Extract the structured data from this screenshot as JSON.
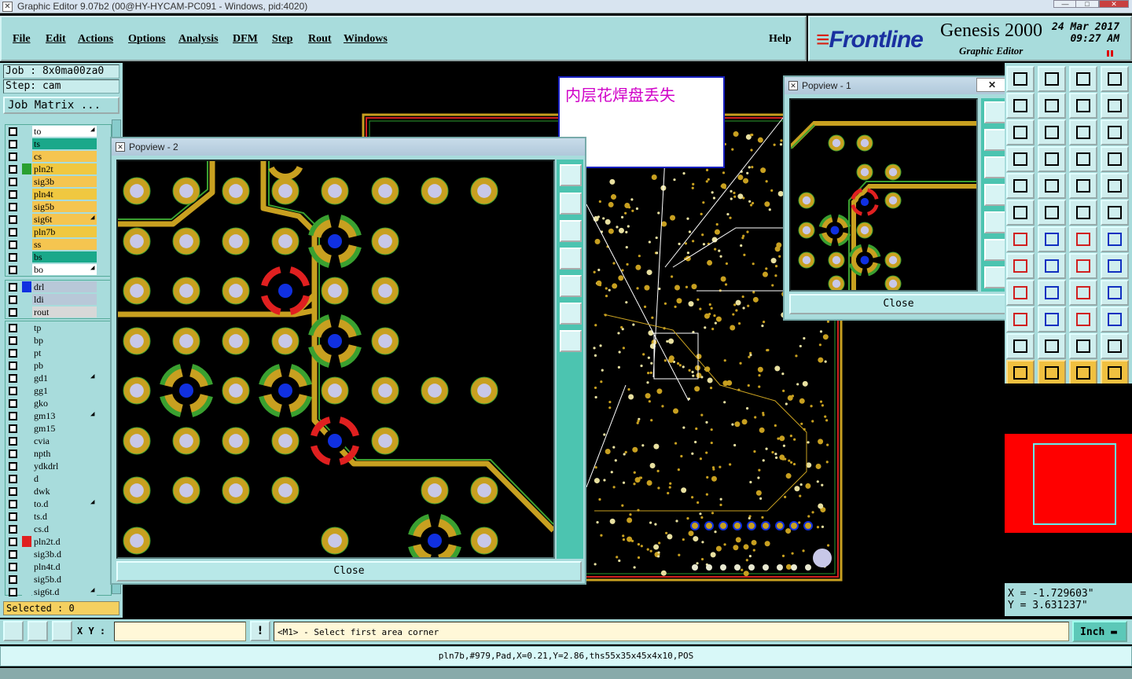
{
  "window": {
    "title": "Graphic Editor 9.07b2 (00@HY-HYCAM-PC091 - Windows, pid:4020)"
  },
  "menu": {
    "items": [
      "File",
      "Edit",
      "Actions",
      "Options",
      "Analysis",
      "DFM",
      "Step",
      "Rout",
      "Windows"
    ],
    "help": "Help"
  },
  "brand": {
    "logo": "Frontline",
    "product": "Genesis 2000",
    "subtitle": "Graphic Editor",
    "date": "24 Mar 2017",
    "time": "09:27 AM"
  },
  "job": {
    "job_label": "Job : 8x0ma00za0",
    "step_label": "Step: cam",
    "matrix_button": "Job Matrix ..."
  },
  "layers_board": [
    {
      "name": "to",
      "color": "#ffffff",
      "arrow": true
    },
    {
      "name": "ts",
      "color": "#1aa88a"
    },
    {
      "name": "cs",
      "color": "#f5c550"
    },
    {
      "name": "pln2t",
      "color": "#f0c840",
      "mark": "#2aa030"
    },
    {
      "name": "sig3b",
      "color": "#f5c550"
    },
    {
      "name": "pln4t",
      "color": "#f0c840"
    },
    {
      "name": "sig5b",
      "color": "#f5c550"
    },
    {
      "name": "sig6t",
      "color": "#f5c550",
      "arrow": true
    },
    {
      "name": "pln7b",
      "color": "#f0c840"
    },
    {
      "name": "ss",
      "color": "#f5c550"
    },
    {
      "name": "bs",
      "color": "#1aa88a"
    },
    {
      "name": "bo",
      "color": "#ffffff",
      "arrow": true
    }
  ],
  "layers_drill": [
    {
      "name": "drl",
      "color": "#b8c8d8",
      "mark": "#1030e0"
    },
    {
      "name": "ldi",
      "color": "#b8c8d8"
    },
    {
      "name": "rout",
      "color": "#d8d8d8"
    }
  ],
  "layers_misc": [
    {
      "name": "tp"
    },
    {
      "name": "bp"
    },
    {
      "name": "pt"
    },
    {
      "name": "pb"
    },
    {
      "name": "gd1",
      "arrow": true
    },
    {
      "name": "gg1"
    },
    {
      "name": "gko"
    },
    {
      "name": "gm13",
      "arrow": true
    },
    {
      "name": "gm15"
    },
    {
      "name": "cvia"
    },
    {
      "name": "npth"
    },
    {
      "name": "ydkdrl"
    },
    {
      "name": "d"
    },
    {
      "name": "dwk"
    },
    {
      "name": "to.d",
      "arrow": true
    },
    {
      "name": "ts.d"
    },
    {
      "name": "cs.d"
    },
    {
      "name": "pln2t.d",
      "mark": "#e02020"
    },
    {
      "name": "sig3b.d"
    },
    {
      "name": "pln4t.d"
    },
    {
      "name": "sig5b.d"
    },
    {
      "name": "sig6t.d",
      "arrow": true
    }
  ],
  "selected": "Selected : 0",
  "note": "内层花焊盘丢失",
  "popview1": {
    "title": "Popview - 1",
    "close": "Close"
  },
  "popview2": {
    "title": "Popview - 2",
    "close": "Close"
  },
  "coords": {
    "x": "X = -1.729603\"",
    "y": "Y = 3.631237\""
  },
  "command": {
    "xy_label": "X Y :",
    "xy_value": "",
    "message": "<M1> - Select first area corner",
    "unit": "Inch"
  },
  "status": "pln7b,#979,Pad,X=0.21,Y=2.86,ths55x35x45x4x10,POS",
  "colors": {
    "app_bg": "#a8dcdc",
    "pad_ring": "#c8a020",
    "pad_center": "#c8c8e8",
    "trace": "#c8a020",
    "thermal_green": "#3aa030",
    "thermal_red": "#e02020",
    "drill": "#1030e0"
  }
}
